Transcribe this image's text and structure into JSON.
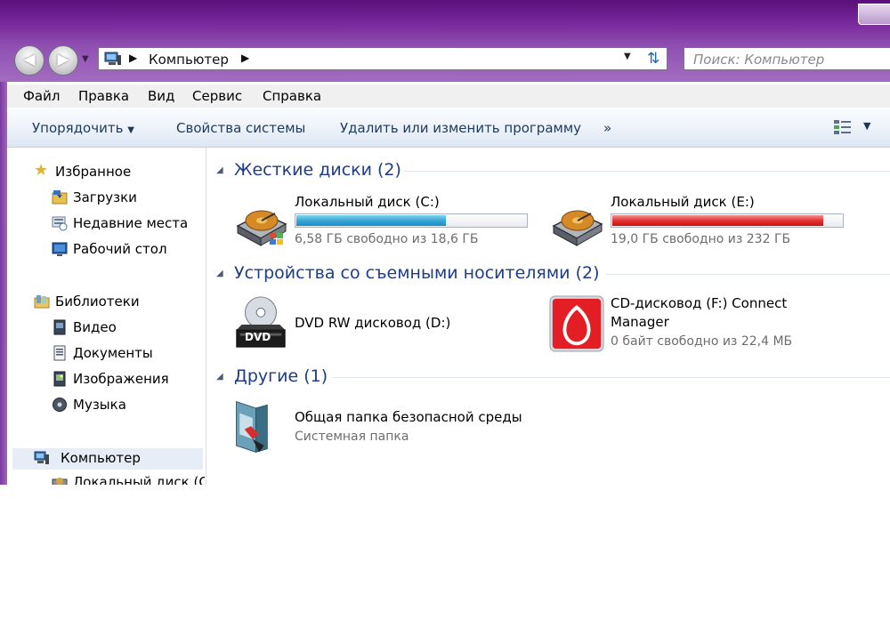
{
  "address": {
    "path": "Компьютер",
    "search_placeholder": "Поиск: Компьютер"
  },
  "menu": [
    "Файл",
    "Правка",
    "Вид",
    "Сервис",
    "Справка"
  ],
  "commands": {
    "organize": "Упорядочить",
    "system_properties": "Свойства системы",
    "uninstall": "Удалить или изменить программу",
    "more": "»"
  },
  "sidebar": {
    "favorites": "Избранное",
    "favorites_items": [
      "Загрузки",
      "Недавние места",
      "Рабочий стол"
    ],
    "libraries": "Библиотеки",
    "library_items": [
      "Видео",
      "Документы",
      "Изображения",
      "Музыка"
    ],
    "computer": "Компьютер",
    "computer_items": [
      "Локальный диск (C"
    ]
  },
  "groups": {
    "hdd": "Жесткие диски (2)",
    "removable": "Устройства со съемными носителями (2)",
    "other": "Другие (1)"
  },
  "drives": {
    "c": {
      "name": "Локальный диск (C:)",
      "free_text": "6,58 ГБ свободно из 18,6 ГБ",
      "used_fraction": 0.65,
      "color": "#1b8ec3"
    },
    "e": {
      "name": "Локальный диск (E:)",
      "free_text": "19,0 ГБ свободно из 232 ГБ",
      "used_fraction": 0.92,
      "color": "#c81212"
    },
    "dvd": {
      "name": "DVD RW дисковод (D:)",
      "label_on_icon": "DVD"
    },
    "cd": {
      "name_line1": "CD-дисковод (F:) Connect",
      "name_line2": "Manager",
      "free_text": "0 байт свободно из 22,4 МБ"
    },
    "shared": {
      "name": "Общая папка безопасной среды",
      "sub": "Системная папка"
    }
  },
  "colors": {
    "frame": "#7a2a9c",
    "group_title": "#1e3c87",
    "command_text": "#1e395b"
  }
}
